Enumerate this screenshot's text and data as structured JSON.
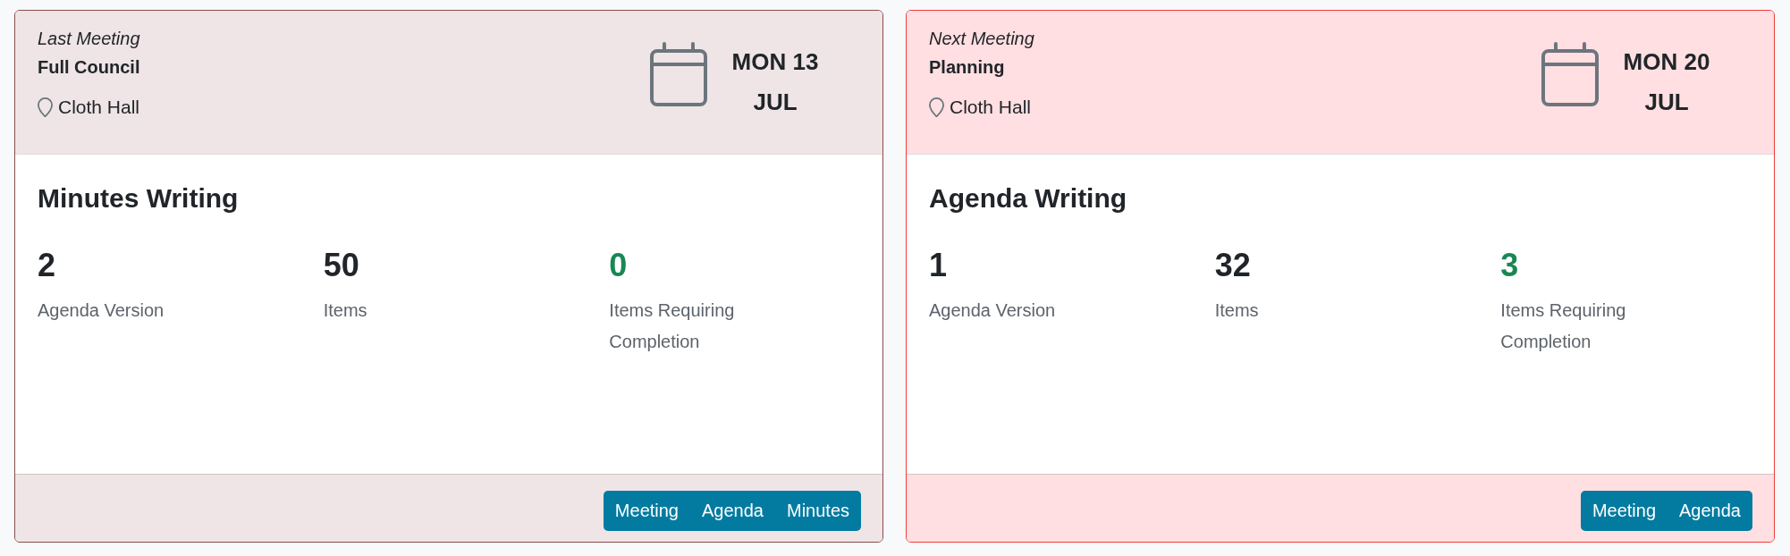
{
  "cards": [
    {
      "kind": "past",
      "label": "Last Meeting",
      "title": "Full Council",
      "location": "Cloth Hall",
      "date": {
        "day": "MON 13",
        "month": "JUL"
      },
      "section": "Minutes Writing",
      "stats": [
        {
          "value": "2",
          "label": "Agenda Version",
          "color": "#212529"
        },
        {
          "value": "50",
          "label": "Items",
          "color": "#212529"
        },
        {
          "value": "0",
          "label": "Items Requiring Completion",
          "color": "#198754"
        }
      ],
      "buttons": [
        "Meeting",
        "Agenda",
        "Minutes"
      ]
    },
    {
      "kind": "upcoming",
      "label": "Next Meeting",
      "title": "Planning",
      "location": "Cloth Hall",
      "date": {
        "day": "MON 20",
        "month": "JUL"
      },
      "section": "Agenda Writing",
      "stats": [
        {
          "value": "1",
          "label": "Agenda Version",
          "color": "#212529"
        },
        {
          "value": "32",
          "label": "Items",
          "color": "#212529"
        },
        {
          "value": "3",
          "label": "Items Requiring Completion",
          "color": "#198754"
        }
      ],
      "buttons": [
        "Meeting",
        "Agenda"
      ]
    }
  ]
}
